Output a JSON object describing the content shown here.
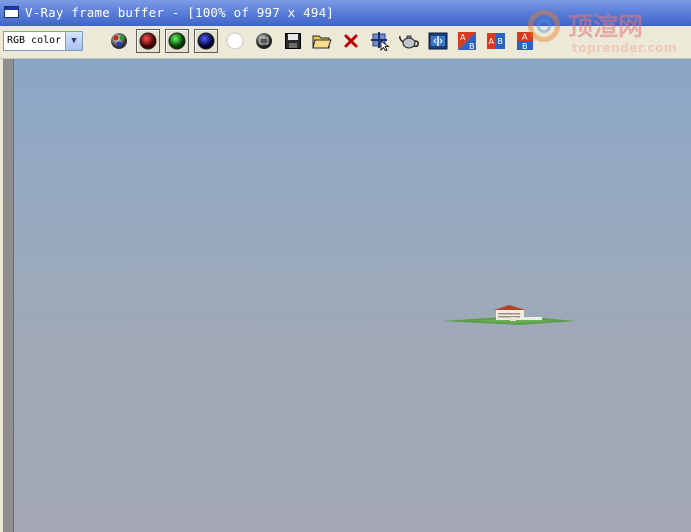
{
  "window": {
    "title": "V-Ray frame buffer - [100% of 997 x 494]"
  },
  "toolbar": {
    "channel": {
      "selected": "RGB color"
    },
    "buttons": [
      {
        "name": "display-color-button",
        "icon": "rgb-channels-icon"
      },
      {
        "name": "view-red-channel-button",
        "icon": "red-channel-icon",
        "color": "#b00000",
        "pressed": true
      },
      {
        "name": "view-green-channel-button",
        "icon": "green-channel-icon",
        "color": "#00a000",
        "pressed": true
      },
      {
        "name": "view-blue-channel-button",
        "icon": "blue-channel-icon",
        "color": "#000080",
        "pressed": true
      },
      {
        "name": "view-alpha-channel-button",
        "icon": "alpha-channel-icon"
      },
      {
        "name": "monochrome-button",
        "icon": "monochrome-icon"
      },
      {
        "name": "save-image-button",
        "icon": "floppy-disk-icon"
      },
      {
        "name": "load-image-button",
        "icon": "open-folder-icon"
      },
      {
        "name": "clear-image-button",
        "icon": "close-x-icon"
      },
      {
        "name": "track-mouse-button",
        "icon": "crosshair-icon"
      },
      {
        "name": "render-last-button",
        "icon": "teapot-icon"
      },
      {
        "name": "color-corrections-button",
        "icon": "film-strip-icon"
      },
      {
        "name": "compare-horizontal-button",
        "icon": "ab-diagonal-icon",
        "label_a": "A",
        "label_b": "B"
      },
      {
        "name": "compare-vertical-button",
        "icon": "ab-vertical-icon",
        "label_a": "A",
        "label_b": "B"
      },
      {
        "name": "compare-stacked-button",
        "icon": "ab-stacked-icon",
        "label_a": "A",
        "label_b": "B"
      }
    ]
  },
  "watermark": {
    "title": "顶渲网",
    "url": "toprender.com"
  }
}
